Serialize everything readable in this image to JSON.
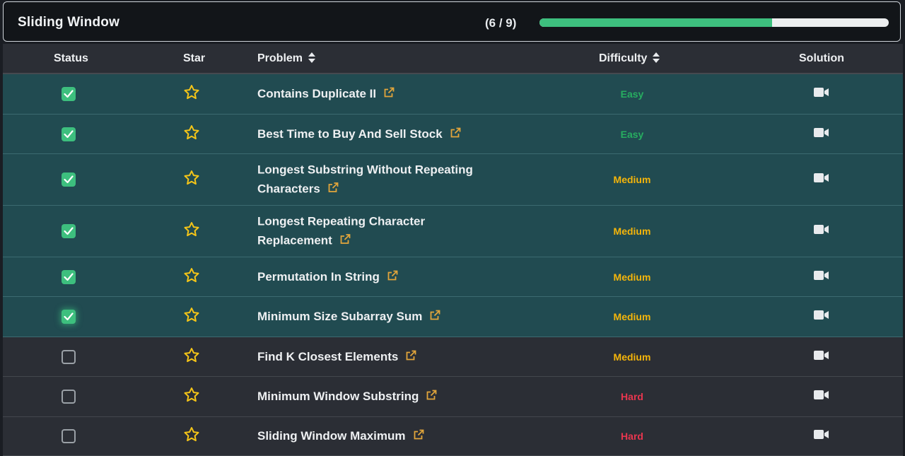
{
  "header": {
    "title": "Sliding Window",
    "count_text": "(6 / 9)",
    "progress_fraction": 0.6667
  },
  "columns": {
    "status": "Status",
    "star": "Star",
    "problem": "Problem",
    "difficulty": "Difficulty",
    "solution": "Solution"
  },
  "colors": {
    "easy": "#27ae60",
    "medium": "#f5b50a",
    "hard": "#e8364f",
    "accent": "#3dbf7e",
    "star": "#f5c518",
    "link": "#e2a53b"
  },
  "rows": [
    {
      "done": true,
      "problem": "Contains Duplicate II",
      "difficulty": "Easy"
    },
    {
      "done": true,
      "problem": "Best Time to Buy And Sell Stock",
      "difficulty": "Easy"
    },
    {
      "done": true,
      "problem": "Longest Substring Without Repeating Characters",
      "difficulty": "Medium"
    },
    {
      "done": true,
      "problem": "Longest Repeating Character Replacement",
      "difficulty": "Medium"
    },
    {
      "done": true,
      "problem": "Permutation In String",
      "difficulty": "Medium"
    },
    {
      "done": true,
      "problem": "Minimum Size Subarray Sum",
      "difficulty": "Medium"
    },
    {
      "done": false,
      "problem": "Find K Closest Elements",
      "difficulty": "Medium"
    },
    {
      "done": false,
      "problem": "Minimum Window Substring",
      "difficulty": "Hard"
    },
    {
      "done": false,
      "problem": "Sliding Window Maximum",
      "difficulty": "Hard"
    }
  ],
  "icons": {
    "status_checked": "checkbox-checked-icon",
    "status_unchecked": "checkbox-empty-icon",
    "star": "star-outline-icon",
    "link": "external-link-icon",
    "solution": "video-camera-icon",
    "sort": "sort-icon"
  }
}
